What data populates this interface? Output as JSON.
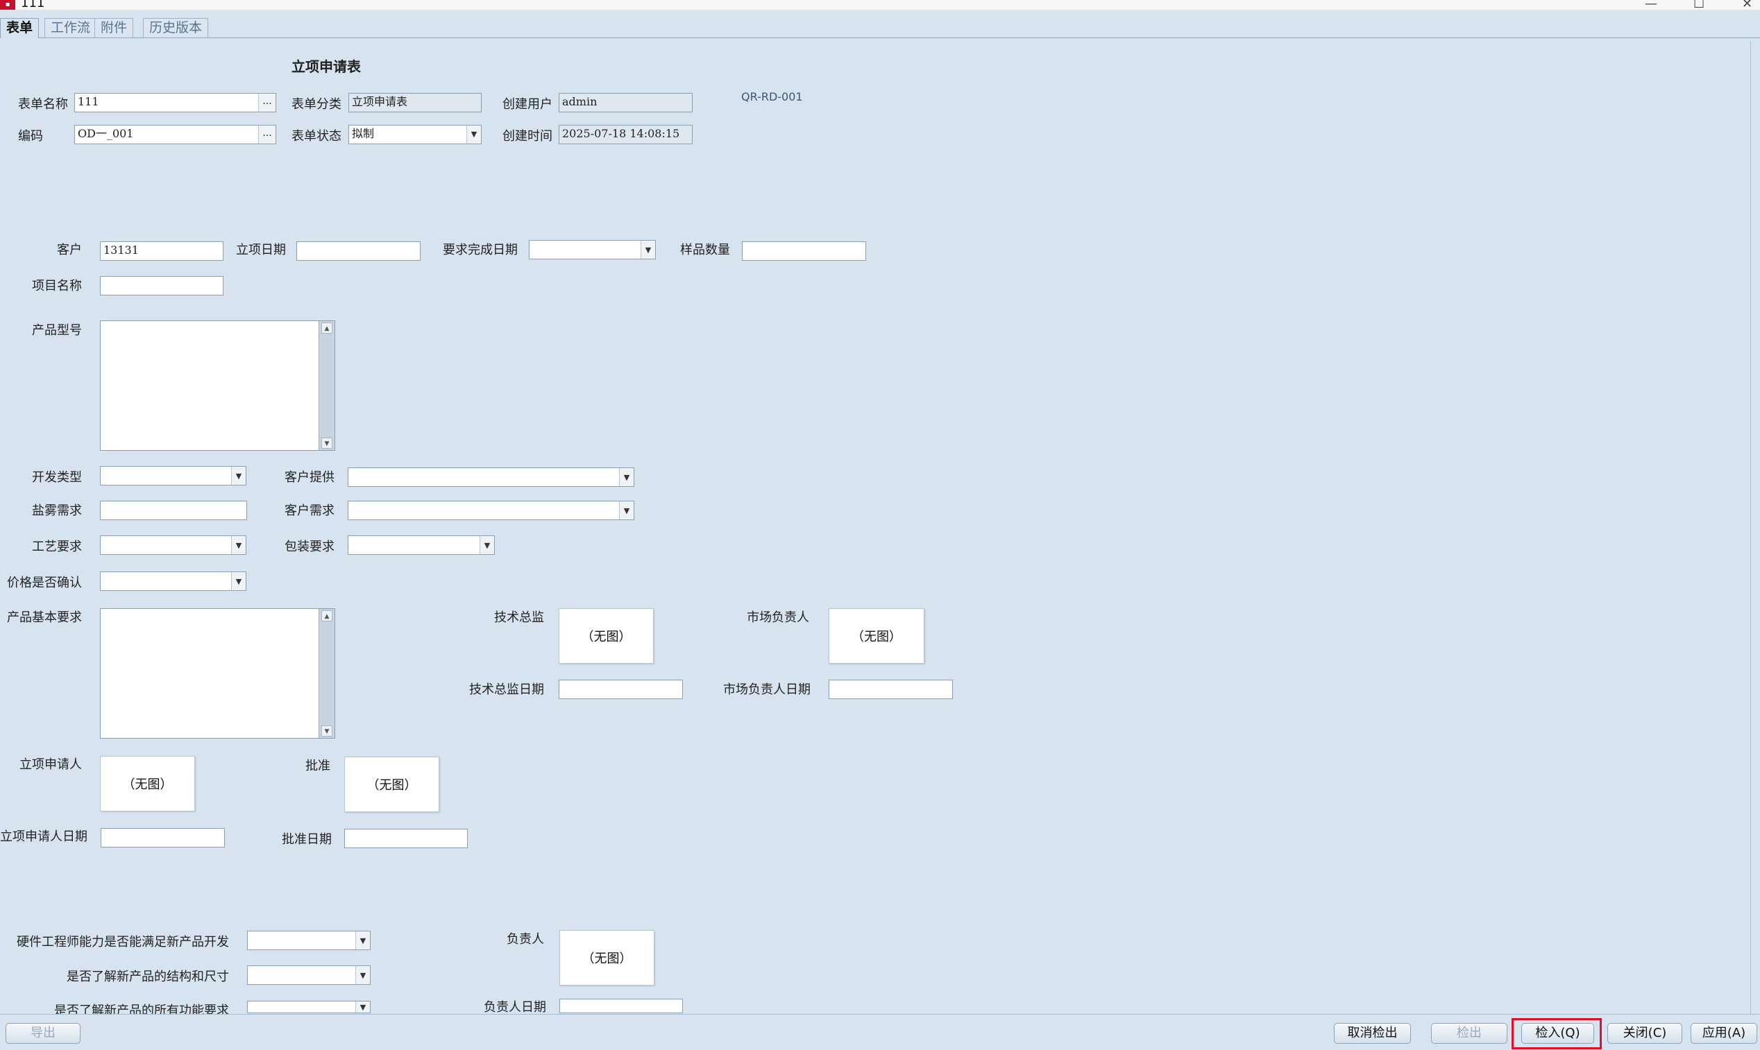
{
  "window": {
    "title": "111",
    "min": "—",
    "max": "☐",
    "close": "✕"
  },
  "tabs": [
    "表单",
    "工作流",
    "附件",
    "历史版本"
  ],
  "form_title": "立项申请表",
  "doc_code": "QR-RD-001",
  "header": {
    "name_label": "表单名称",
    "name_value": "111",
    "code_label": "编码",
    "code_value": "OD一_001",
    "category_label": "表单分类",
    "category_value": "立项申请表",
    "status_label": "表单状态",
    "status_value": "拟制",
    "creator_label": "创建用户",
    "creator_value": "admin",
    "created_label": "创建时间",
    "created_value": "2025-07-18 14:08:15",
    "ellipsis": "..."
  },
  "fields": {
    "customer_label": "客户",
    "customer_value": "13131",
    "project_date_label": "立项日期",
    "due_date_label": "要求完成日期",
    "sample_qty_label": "样品数量",
    "project_name_label": "项目名称",
    "model_label": "产品型号",
    "dev_type_label": "开发类型",
    "customer_provide_label": "客户提供",
    "salt_spray_label": "盐雾需求",
    "customer_need_label": "客户需求",
    "process_label": "工艺要求",
    "package_label": "包装要求",
    "price_confirm_label": "价格是否确认",
    "basic_req_label": "产品基本要求",
    "tech_director_label": "技术总监",
    "tech_director_date_label": "技术总监日期",
    "market_owner_label": "市场负责人",
    "market_owner_date_label": "市场负责人日期",
    "applicant_label": "立项申请人",
    "applicant_date_label": "立项申请人日期",
    "approve_label": "批准",
    "approve_date_label": "批准日期",
    "hw_capability_label": "硬件工程师能力是否能满足新产品开发",
    "know_structure_label": "是否了解新产品的结构和尺寸",
    "know_function_label": "是否了解新产品的所有功能要求",
    "owner_label": "负责人",
    "owner_date_label": "负责人日期",
    "no_image": "（无图）"
  },
  "buttons": {
    "export": "导出",
    "cancel_checkout": "取消检出",
    "checkout": "检出",
    "checkin": "检入(Q)",
    "close": "关闭(C)",
    "apply": "应用(A)"
  },
  "colors": {
    "background": "#d7e4ef",
    "highlight": "#e0102a"
  }
}
